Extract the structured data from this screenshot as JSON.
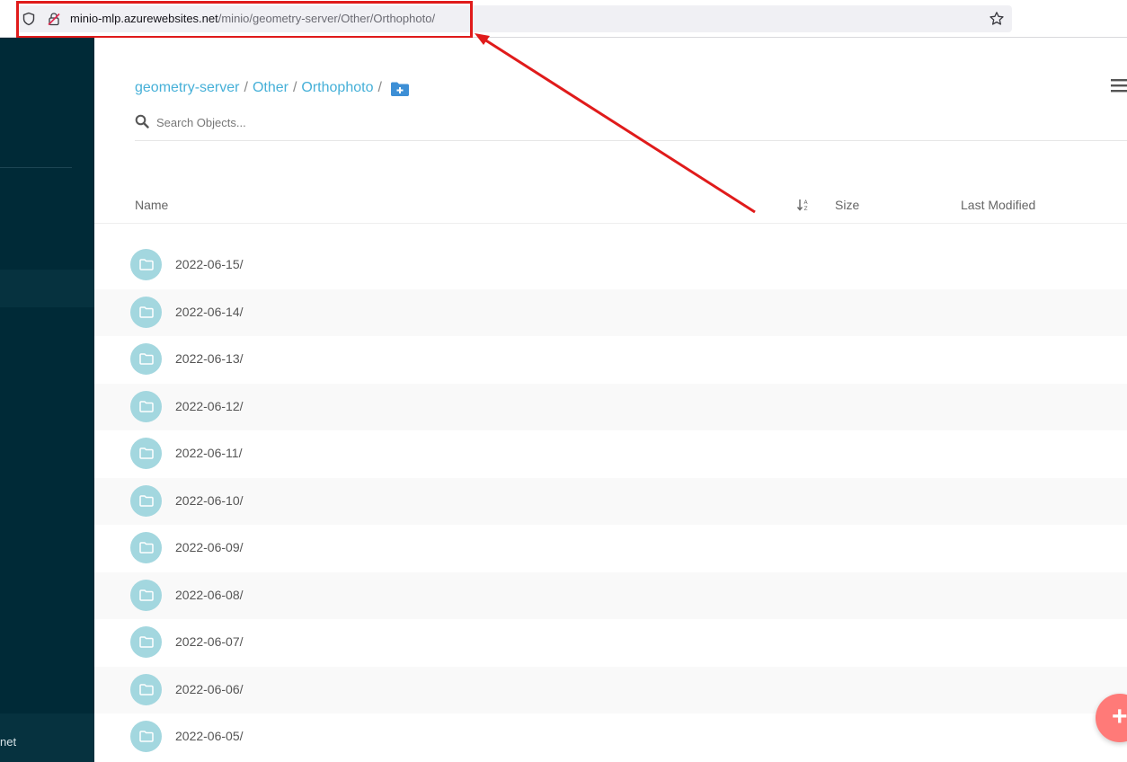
{
  "browser": {
    "url_host": "minio-mlp.azurewebsites.net",
    "url_path": "/minio/geometry-server/Other/Orthophoto/"
  },
  "sidebar": {
    "bottom_text": "net"
  },
  "breadcrumb": {
    "items": [
      "geometry-server",
      "Other",
      "Orthophoto"
    ],
    "separator": "/"
  },
  "search": {
    "placeholder": "Search Objects..."
  },
  "table": {
    "columns": {
      "name": "Name",
      "size": "Size",
      "last_modified": "Last Modified"
    },
    "rows": [
      "2022-06-15/",
      "2022-06-14/",
      "2022-06-13/",
      "2022-06-12/",
      "2022-06-11/",
      "2022-06-10/",
      "2022-06-09/",
      "2022-06-08/",
      "2022-06-07/",
      "2022-06-06/",
      "2022-06-05/"
    ]
  },
  "fab": {
    "label": "+"
  },
  "colors": {
    "sidebar": "#002a37",
    "accent_link": "#46b0d8",
    "folder_icon_bg": "#a3d7df",
    "fab": "#ff7a78",
    "annotation_red": "#e01b1b"
  }
}
